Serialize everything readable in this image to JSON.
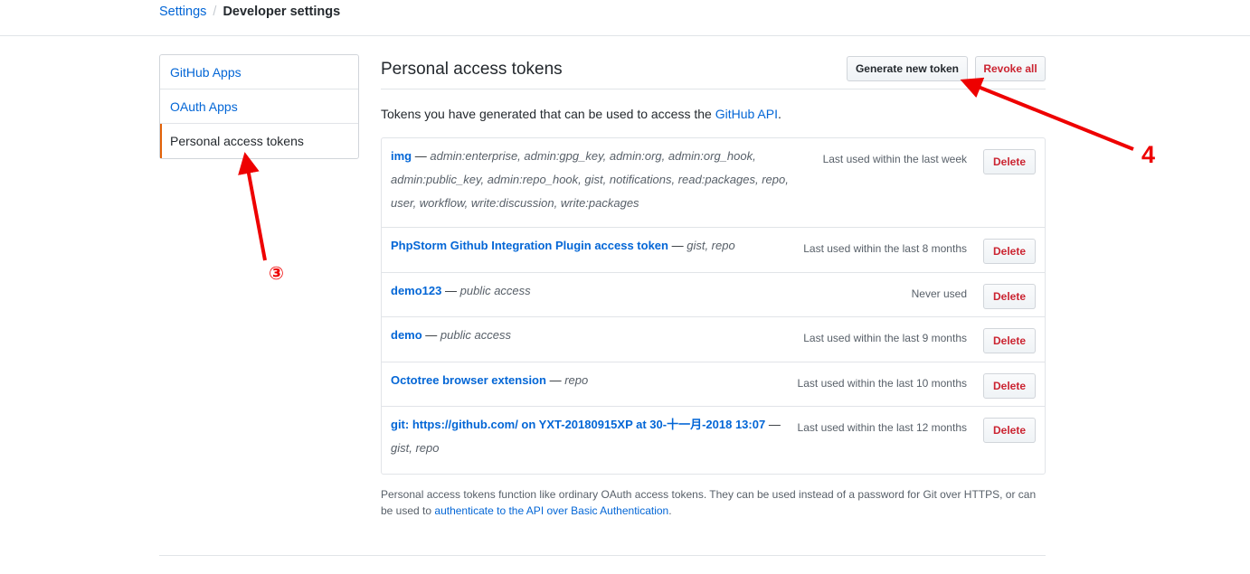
{
  "breadcrumb": {
    "parent": "Settings",
    "separator": "/",
    "current": "Developer settings"
  },
  "sidebar": {
    "items": [
      {
        "label": "GitHub Apps"
      },
      {
        "label": "OAuth Apps"
      },
      {
        "label": "Personal access tokens"
      }
    ]
  },
  "header": {
    "title": "Personal access tokens",
    "generate_label": "Generate new token",
    "revoke_label": "Revoke all"
  },
  "intro": {
    "text": "Tokens you have generated that can be used to access the ",
    "link": "GitHub API",
    "suffix": "."
  },
  "tokens": [
    {
      "name": "img",
      "scopes": "admin:enterprise, admin:gpg_key, admin:org, admin:org_hook, admin:public_key, admin:repo_hook, gist, notifications, read:packages, repo, user, workflow, write:discussion, write:packages",
      "last_used": "Last used within the last week",
      "delete_label": "Delete"
    },
    {
      "name": "PhpStorm Github Integration Plugin access token",
      "scopes": "gist, repo",
      "last_used": "Last used within the last 8 months",
      "delete_label": "Delete"
    },
    {
      "name": "demo123",
      "scopes": "public access",
      "last_used": "Never used",
      "delete_label": "Delete"
    },
    {
      "name": "demo",
      "scopes": "public access",
      "last_used": "Last used within the last 9 months",
      "delete_label": "Delete"
    },
    {
      "name": "Octotree browser extension",
      "scopes": "repo",
      "last_used": "Last used within the last 10 months",
      "delete_label": "Delete"
    },
    {
      "name": "git: https://github.com/ on YXT-20180915XP at 30-十一月-2018 13:07",
      "scopes": "gist, repo",
      "last_used": "Last used within the last 12 months",
      "delete_label": "Delete"
    }
  ],
  "footnote": {
    "text": "Personal access tokens function like ordinary OAuth access tokens. They can be used instead of a password for Git over HTTPS, or can be used to ",
    "link": "authenticate to the API over Basic Authentication",
    "suffix": "."
  },
  "annotations": {
    "marker_4": "4",
    "marker_3": "③",
    "color": "#ee0000"
  }
}
